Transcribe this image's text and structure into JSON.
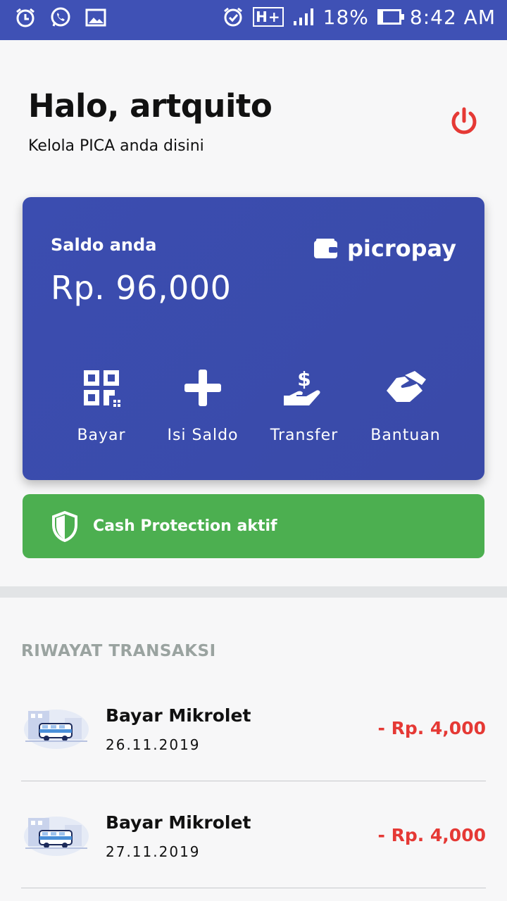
{
  "status_bar": {
    "battery": "18%",
    "time": "8:42 AM",
    "network": "H+",
    "icons": [
      "alarm-icon",
      "whatsapp-icon",
      "gallery-icon",
      "alarm-clock-icon",
      "signal-icon",
      "battery-icon"
    ]
  },
  "header": {
    "greeting": "Halo, artquito",
    "subtitle": "Kelola PICA anda disini"
  },
  "card": {
    "label": "Saldo anda",
    "amount": "Rp. 96,000",
    "brand": "picropay",
    "actions": [
      {
        "label": "Bayar",
        "icon": "qr-code-icon"
      },
      {
        "label": "Isi Saldo",
        "icon": "plus-icon"
      },
      {
        "label": "Transfer",
        "icon": "dollar-hand-icon"
      },
      {
        "label": "Bantuan",
        "icon": "handshake-icon"
      }
    ]
  },
  "protection": {
    "label": "Cash Protection aktif"
  },
  "history": {
    "title": "RIWAYAT TRANSAKSI",
    "items": [
      {
        "title": "Bayar Mikrolet",
        "date": "26.11.2019",
        "amount": "- Rp. 4,000"
      },
      {
        "title": "Bayar Mikrolet",
        "date": "27.11.2019",
        "amount": "- Rp. 4,000"
      }
    ]
  },
  "colors": {
    "primary": "#3f51b5",
    "card": "#3b4db0",
    "success": "#4caf50",
    "danger": "#e53935",
    "muted": "#9aa3a0"
  }
}
